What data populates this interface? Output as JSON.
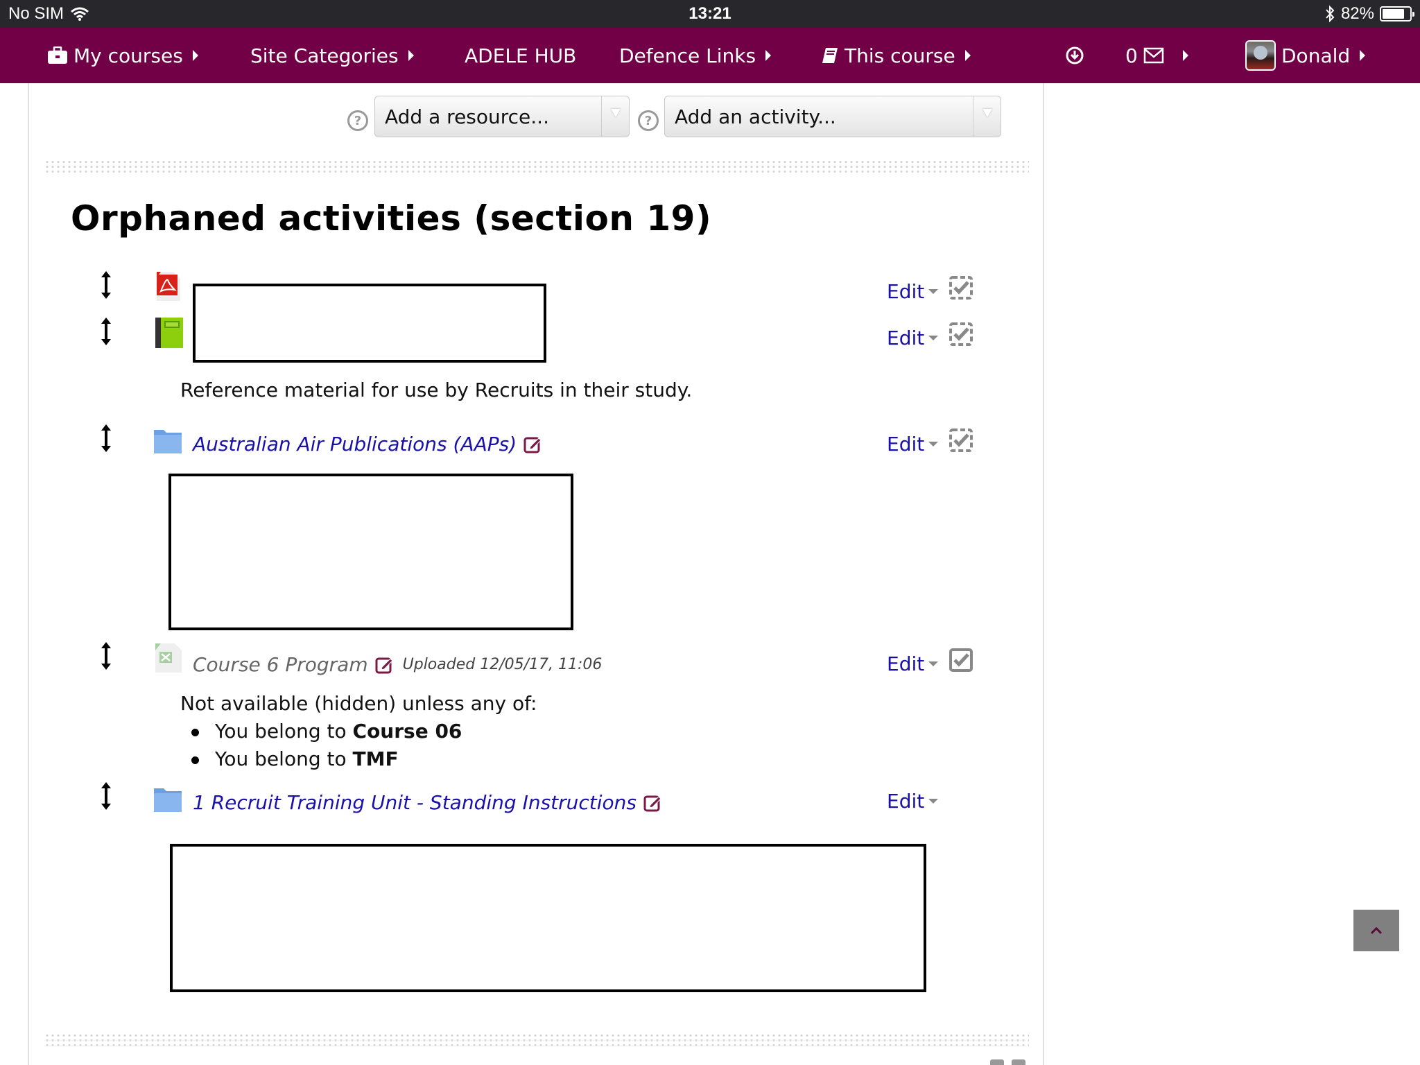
{
  "status_bar": {
    "carrier": "No SIM",
    "time": "13:21",
    "battery_percent_label": "82%",
    "battery_level": 0.82,
    "icons": [
      "wifi-icon",
      "bluetooth-icon",
      "battery-icon"
    ]
  },
  "navbar": {
    "items": [
      {
        "label": "My courses",
        "icon": "briefcase-icon",
        "has_submenu": true
      },
      {
        "label": "Site Categories",
        "has_submenu": true
      },
      {
        "label": "ADELE HUB",
        "has_submenu": false
      },
      {
        "label": "Defence Links",
        "has_submenu": true
      },
      {
        "label": "This course",
        "icon": "book-icon",
        "has_submenu": true
      }
    ],
    "download_icon": "download-circle-icon",
    "messages_count": "0",
    "messages_icon": "envelope-icon",
    "user_name": "Donald"
  },
  "toolbar": {
    "add_resource": "Add a resource...",
    "add_activity": "Add an activity..."
  },
  "section": {
    "title": "Orphaned activities (section 19)",
    "edit_label": "Edit",
    "activities": [
      {
        "type": "pdf",
        "icon": "pdf-file-icon",
        "name": "",
        "redacted": true,
        "completion": "manual-dashed"
      },
      {
        "type": "book",
        "icon": "book-green-icon",
        "name": "",
        "redacted": true,
        "completion": "manual-dashed",
        "description": "Reference material for use by Recruits in their study."
      },
      {
        "type": "folder",
        "icon": "folder-icon",
        "name": "Australian Air Publications (AAPs)",
        "completion": "manual-dashed",
        "content_redacted": true
      },
      {
        "type": "spreadsheet",
        "icon": "excel-file-icon",
        "name": "Course 6 Program",
        "dimmed": true,
        "uploaded": "Uploaded 12/05/17, 11:06",
        "completion": "manual-solid",
        "restriction": {
          "intro": "Not available (hidden) unless any of:",
          "conditions": [
            {
              "prefix": "You belong to ",
              "group": "Course 06"
            },
            {
              "prefix": "You belong to ",
              "group": "TMF"
            }
          ]
        }
      },
      {
        "type": "folder",
        "icon": "folder-icon",
        "name": "1 Recruit Training Unit - Standing Instructions",
        "completion": "none",
        "content_redacted": true
      }
    ]
  },
  "colors": {
    "brand": "#720046",
    "link": "#1a12a8",
    "status_bar": "#28272c"
  }
}
